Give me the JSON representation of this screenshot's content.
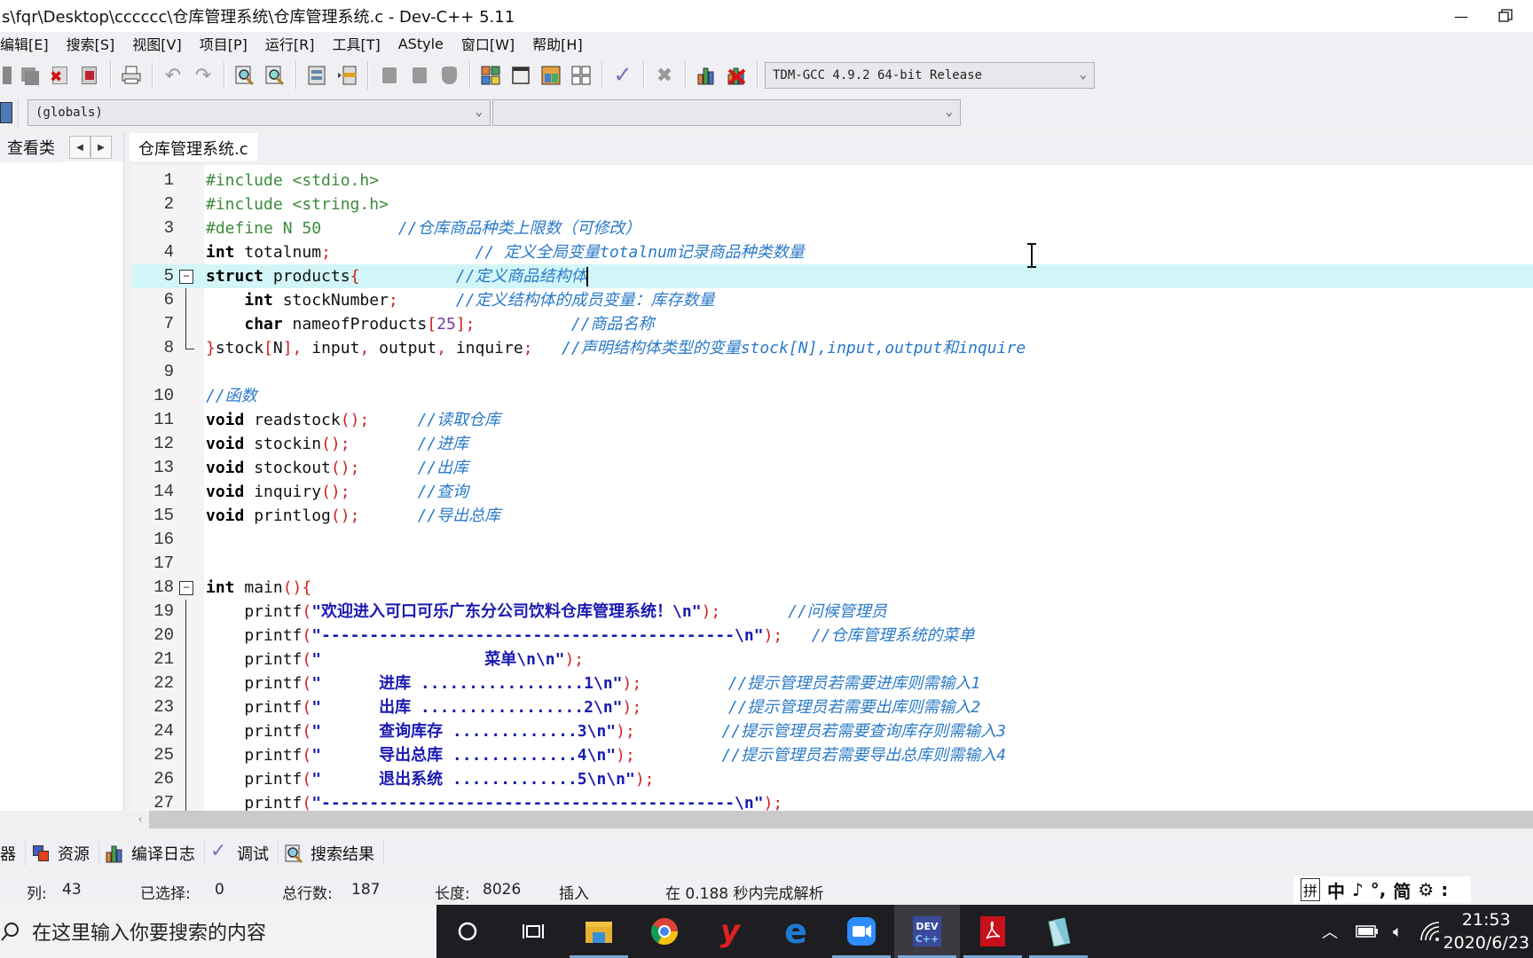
{
  "window": {
    "title": "s\\fqr\\Desktop\\cccccc\\仓库管理系统\\仓库管理系统.c - Dev-C++ 5.11"
  },
  "menu": [
    "编辑[E]",
    "搜索[S]",
    "视图[V]",
    "项目[P]",
    "运行[R]",
    "工具[T]",
    "AStyle",
    "窗口[W]",
    "帮助[H]"
  ],
  "toolbar": {
    "compiler_select": "TDM-GCC 4.9.2 64-bit Release",
    "scope_select": "(globals)",
    "function_select": ""
  },
  "left_panel": {
    "tab_label": "查看类"
  },
  "editor": {
    "tab_label": "仓库管理系统.c",
    "current_line": 5,
    "lines": [
      {
        "n": "1",
        "tokens": [
          [
            "pp",
            "#include <stdio.h>"
          ]
        ]
      },
      {
        "n": "2",
        "tokens": [
          [
            "pp",
            "#include <string.h>"
          ]
        ]
      },
      {
        "n": "3",
        "tokens": [
          [
            "pp",
            "#define N 50"
          ],
          [
            "id",
            "        "
          ],
          [
            "cm",
            "//仓库商品种类上限数（可修改）"
          ]
        ]
      },
      {
        "n": "4",
        "tokens": [
          [
            "kw",
            "int"
          ],
          [
            "id",
            " totalnum"
          ],
          [
            "sym",
            ";"
          ],
          [
            "id",
            "               "
          ],
          [
            "cm",
            "// 定义全局变量totalnum记录商品种类数量"
          ]
        ]
      },
      {
        "n": "5",
        "fold": "open",
        "tokens": [
          [
            "kw",
            "struct"
          ],
          [
            "id",
            " products"
          ],
          [
            "sym",
            "{"
          ],
          [
            "id",
            "          "
          ],
          [
            "cm",
            "//定义商品结构体"
          ]
        ]
      },
      {
        "n": "6",
        "fold": "line",
        "tokens": [
          [
            "id",
            "    "
          ],
          [
            "kw",
            "int"
          ],
          [
            "id",
            " stockNumber"
          ],
          [
            "sym",
            ";"
          ],
          [
            "id",
            "      "
          ],
          [
            "cm",
            "//定义结构体的成员变量：库存数量"
          ]
        ]
      },
      {
        "n": "7",
        "fold": "line",
        "tokens": [
          [
            "id",
            "    "
          ],
          [
            "kw",
            "char"
          ],
          [
            "id",
            " nameofProducts"
          ],
          [
            "sym",
            "["
          ],
          [
            "num",
            "25"
          ],
          [
            "sym",
            "];"
          ],
          [
            "id",
            "          "
          ],
          [
            "cm",
            "//商品名称"
          ]
        ]
      },
      {
        "n": "8",
        "fold": "end",
        "tokens": [
          [
            "sym",
            "}"
          ],
          [
            "id",
            "stock"
          ],
          [
            "sym",
            "["
          ],
          [
            "id",
            "N"
          ],
          [
            "sym",
            "],"
          ],
          [
            "id",
            " input"
          ],
          [
            "sym",
            ","
          ],
          [
            "id",
            " output"
          ],
          [
            "sym",
            ","
          ],
          [
            "id",
            " inquire"
          ],
          [
            "sym",
            ";"
          ],
          [
            "id",
            "   "
          ],
          [
            "cm",
            "//声明结构体类型的变量stock[N],input,output和inquire"
          ]
        ]
      },
      {
        "n": "9",
        "tokens": []
      },
      {
        "n": "10",
        "tokens": [
          [
            "cm",
            "//函数"
          ]
        ]
      },
      {
        "n": "11",
        "tokens": [
          [
            "kw",
            "void"
          ],
          [
            "id",
            " readstock"
          ],
          [
            "sym",
            "();"
          ],
          [
            "id",
            "     "
          ],
          [
            "cm",
            "//读取仓库"
          ]
        ]
      },
      {
        "n": "12",
        "tokens": [
          [
            "kw",
            "void"
          ],
          [
            "id",
            " stockin"
          ],
          [
            "sym",
            "();"
          ],
          [
            "id",
            "       "
          ],
          [
            "cm",
            "//进库"
          ]
        ]
      },
      {
        "n": "13",
        "tokens": [
          [
            "kw",
            "void"
          ],
          [
            "id",
            " stockout"
          ],
          [
            "sym",
            "();"
          ],
          [
            "id",
            "      "
          ],
          [
            "cm",
            "//出库"
          ]
        ]
      },
      {
        "n": "14",
        "tokens": [
          [
            "kw",
            "void"
          ],
          [
            "id",
            " inquiry"
          ],
          [
            "sym",
            "();"
          ],
          [
            "id",
            "       "
          ],
          [
            "cm",
            "//查询"
          ]
        ]
      },
      {
        "n": "15",
        "tokens": [
          [
            "kw",
            "void"
          ],
          [
            "id",
            " printlog"
          ],
          [
            "sym",
            "();"
          ],
          [
            "id",
            "      "
          ],
          [
            "cm",
            "//导出总库"
          ]
        ]
      },
      {
        "n": "16",
        "tokens": []
      },
      {
        "n": "17",
        "tokens": []
      },
      {
        "n": "18",
        "fold": "open",
        "tokens": [
          [
            "kw",
            "int"
          ],
          [
            "id",
            " main"
          ],
          [
            "sym",
            "(){"
          ]
        ]
      },
      {
        "n": "19",
        "fold": "line",
        "tokens": [
          [
            "id",
            "    printf"
          ],
          [
            "sym",
            "("
          ],
          [
            "st",
            "\"欢迎进入可口可乐广东分公司饮料仓库管理系统！\\n\""
          ],
          [
            "sym",
            ");"
          ],
          [
            "id",
            "       "
          ],
          [
            "cm",
            "//问候管理员"
          ]
        ]
      },
      {
        "n": "20",
        "fold": "line",
        "tokens": [
          [
            "id",
            "    printf"
          ],
          [
            "sym",
            "("
          ],
          [
            "st",
            "\"-------------------------------------------\\n\""
          ],
          [
            "sym",
            ");"
          ],
          [
            "id",
            "   "
          ],
          [
            "cm",
            "//仓库管理系统的菜单"
          ]
        ]
      },
      {
        "n": "21",
        "fold": "line",
        "tokens": [
          [
            "id",
            "    printf"
          ],
          [
            "sym",
            "("
          ],
          [
            "st",
            "\"                 菜单\\n\\n\""
          ],
          [
            "sym",
            ");"
          ]
        ]
      },
      {
        "n": "22",
        "fold": "line",
        "tokens": [
          [
            "id",
            "    printf"
          ],
          [
            "sym",
            "("
          ],
          [
            "st",
            "\"      进库 .................1\\n\""
          ],
          [
            "sym",
            ");"
          ],
          [
            "id",
            "         "
          ],
          [
            "cm",
            "//提示管理员若需要进库则需输入1"
          ]
        ]
      },
      {
        "n": "23",
        "fold": "line",
        "tokens": [
          [
            "id",
            "    printf"
          ],
          [
            "sym",
            "("
          ],
          [
            "st",
            "\"      出库 .................2\\n\""
          ],
          [
            "sym",
            ");"
          ],
          [
            "id",
            "         "
          ],
          [
            "cm",
            "//提示管理员若需要出库则需输入2"
          ]
        ]
      },
      {
        "n": "24",
        "fold": "line",
        "tokens": [
          [
            "id",
            "    printf"
          ],
          [
            "sym",
            "("
          ],
          [
            "st",
            "\"      查询库存 .............3\\n\""
          ],
          [
            "sym",
            ");"
          ],
          [
            "id",
            "         "
          ],
          [
            "cm",
            "//提示管理员若需要查询库存则需输入3"
          ]
        ]
      },
      {
        "n": "25",
        "fold": "line",
        "tokens": [
          [
            "id",
            "    printf"
          ],
          [
            "sym",
            "("
          ],
          [
            "st",
            "\"      导出总库 .............4\\n\""
          ],
          [
            "sym",
            ");"
          ],
          [
            "id",
            "         "
          ],
          [
            "cm",
            "//提示管理员若需要导出总库则需输入4"
          ]
        ]
      },
      {
        "n": "26",
        "fold": "line",
        "tokens": [
          [
            "id",
            "    printf"
          ],
          [
            "sym",
            "("
          ],
          [
            "st",
            "\"      退出系统 .............5\\n\\n\""
          ],
          [
            "sym",
            ");"
          ]
        ]
      },
      {
        "n": "27",
        "fold": "line",
        "tokens": [
          [
            "id",
            "    printf"
          ],
          [
            "sym",
            "("
          ],
          [
            "st",
            "\"-------------------------------------------\\n\""
          ],
          [
            "sym",
            ");"
          ]
        ]
      }
    ]
  },
  "bottom_tabs": [
    "器",
    "资源",
    "编译日志",
    "调试",
    "搜索结果"
  ],
  "status": {
    "col_label": "列:",
    "col_value": "43",
    "selected_label": "已选择:",
    "selected_value": "0",
    "total_lines_label": "总行数:",
    "total_lines_value": "187",
    "length_label": "长度:",
    "length_value": "8026",
    "mode": "插入",
    "parse_message": "在 0.188 秒内完成解析"
  },
  "ime": [
    "拼",
    "中",
    "♪",
    "°,",
    "简",
    "⚙",
    ":"
  ],
  "taskbar": {
    "search_placeholder": "在这里输入你要搜索的内容",
    "time": "21:53",
    "date": "2020/6/23"
  }
}
